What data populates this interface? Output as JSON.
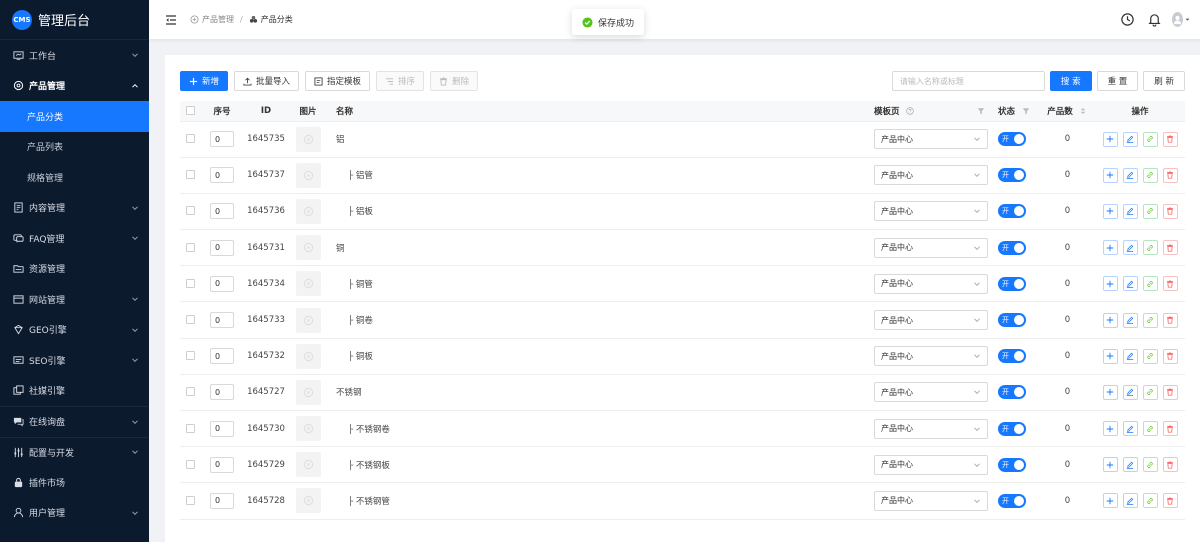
{
  "brand": {
    "logo": "CMS",
    "title": "管理后台"
  },
  "sidebar": {
    "items": [
      {
        "label": "工作台",
        "icon": "dashboard-icon",
        "has_children": true
      },
      {
        "label": "产品管理",
        "icon": "product-icon",
        "has_children": true,
        "open": true,
        "children": [
          {
            "label": "产品分类",
            "active": true
          },
          {
            "label": "产品列表"
          },
          {
            "label": "规格管理"
          }
        ]
      },
      {
        "label": "内容管理",
        "icon": "content-icon",
        "has_children": true
      },
      {
        "label": "FAQ管理",
        "icon": "faq-icon",
        "has_children": true
      },
      {
        "label": "资源管理",
        "icon": "resource-icon",
        "has_children": false
      },
      {
        "label": "网站管理",
        "icon": "site-icon",
        "has_children": true
      },
      {
        "label": "GEO引擎",
        "icon": "geo-icon",
        "has_children": true
      },
      {
        "label": "SEO引擎",
        "icon": "seo-icon",
        "has_children": true
      },
      {
        "label": "社媒引擎",
        "icon": "social-icon",
        "has_children": false
      },
      {
        "label": "在线询盘",
        "icon": "inquiry-icon",
        "has_children": true
      },
      {
        "label": "配置与开发",
        "icon": "config-icon",
        "has_children": true
      },
      {
        "label": "插件市场",
        "icon": "plugin-icon",
        "has_children": false
      },
      {
        "label": "用户管理",
        "icon": "user-icon",
        "has_children": true
      }
    ]
  },
  "breadcrumb": {
    "parent": "产品管理",
    "current": "产品分类"
  },
  "toast": {
    "text": "保存成功"
  },
  "toolbar": {
    "add": "新增",
    "import": "批量导入",
    "template": "指定模板",
    "sort": "排序",
    "delete": "删除"
  },
  "search": {
    "placeholder": "请输入名称或标题",
    "search": "搜 索",
    "reset": "重 置",
    "refresh": "刷 新"
  },
  "table": {
    "headers": {
      "sort": "序号",
      "id": "ID",
      "image": "图片",
      "name": "名称",
      "template": "模板页",
      "status": "状态",
      "count": "产品数",
      "ops": "操作"
    },
    "switch_on": "开",
    "rows": [
      {
        "sort": "0",
        "id": "1645735",
        "name": "铝",
        "child": false,
        "template": "产品中心",
        "count": "0"
      },
      {
        "sort": "0",
        "id": "1645737",
        "name": "├ 铝管",
        "child": true,
        "template": "产品中心",
        "count": "0"
      },
      {
        "sort": "0",
        "id": "1645736",
        "name": "├ 铝板",
        "child": true,
        "template": "产品中心",
        "count": "0"
      },
      {
        "sort": "0",
        "id": "1645731",
        "name": "铜",
        "child": false,
        "template": "产品中心",
        "count": "0"
      },
      {
        "sort": "0",
        "id": "1645734",
        "name": "├ 铜管",
        "child": true,
        "template": "产品中心",
        "count": "0"
      },
      {
        "sort": "0",
        "id": "1645733",
        "name": "├ 铜卷",
        "child": true,
        "template": "产品中心",
        "count": "0"
      },
      {
        "sort": "0",
        "id": "1645732",
        "name": "├ 铜板",
        "child": true,
        "template": "产品中心",
        "count": "0"
      },
      {
        "sort": "0",
        "id": "1645727",
        "name": "不锈钢",
        "child": false,
        "template": "产品中心",
        "count": "0"
      },
      {
        "sort": "0",
        "id": "1645730",
        "name": "├ 不锈钢卷",
        "child": true,
        "template": "产品中心",
        "count": "0"
      },
      {
        "sort": "0",
        "id": "1645729",
        "name": "├ 不锈钢板",
        "child": true,
        "template": "产品中心",
        "count": "0"
      },
      {
        "sort": "0",
        "id": "1645728",
        "name": "├ 不锈钢管",
        "child": true,
        "template": "产品中心",
        "count": "0"
      }
    ]
  },
  "colors": {
    "primary": "#1677ff",
    "sidebar_bg": "#0c1a2e",
    "success": "#52c41a",
    "danger": "#ff4d4f"
  }
}
